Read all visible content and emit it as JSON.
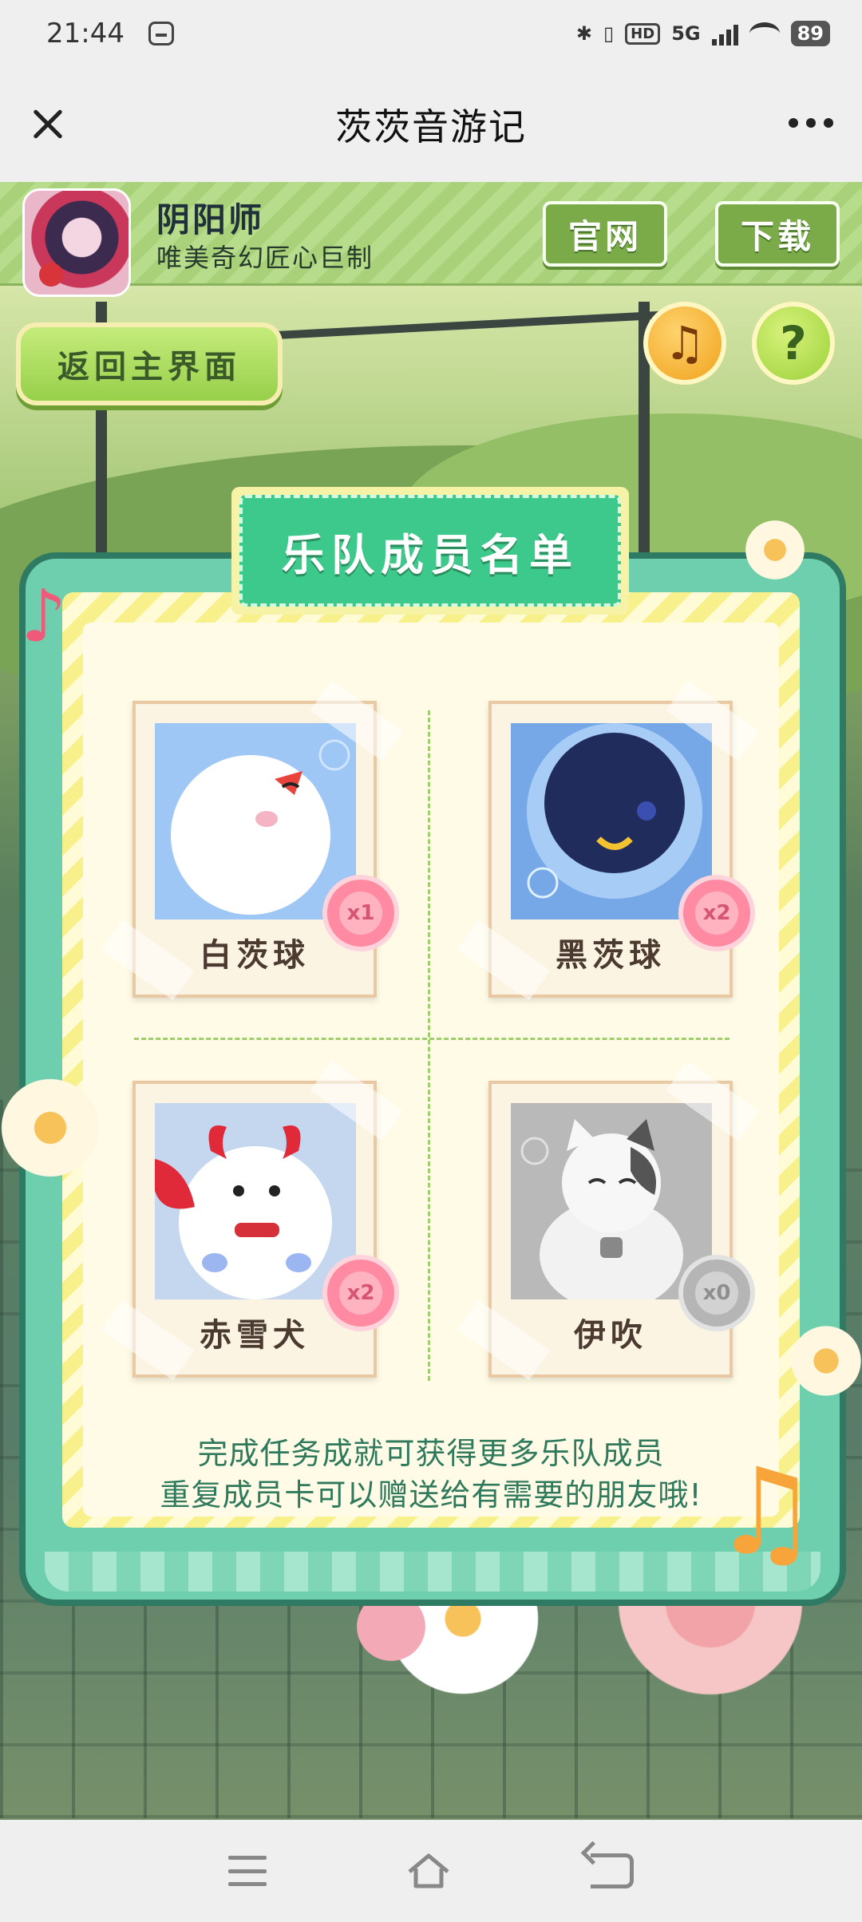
{
  "status_bar": {
    "time": "21:44",
    "indicators": [
      "bluetooth-icon",
      "vibrate-icon",
      "HD",
      "5G",
      "signal-icon",
      "wifi-icon"
    ],
    "hd": "HD",
    "network": "5G",
    "battery": "89"
  },
  "title_bar": {
    "title": "茨茨音游记",
    "close_icon": "close-icon",
    "more_icon": "more-icon"
  },
  "banner": {
    "game_name": "阴阳师",
    "slogan": "唯美奇幻匠心巨制",
    "official_label": "官网",
    "download_label": "下载"
  },
  "scene": {
    "back_label": "返回主界面",
    "music_symbol": "♫",
    "help_symbol": "?"
  },
  "panel": {
    "title": "乐队成员名单",
    "members": [
      {
        "name": "白茨球",
        "count": "x1"
      },
      {
        "name": "黑茨球",
        "count": "x2"
      },
      {
        "name": "赤雪犬",
        "count": "x2"
      },
      {
        "name": "伊吹",
        "count": "x0"
      }
    ],
    "tip_line1": "完成任务成就可获得更多乐队成员",
    "tip_line2": "重复成员卡可以赠送给有需要的朋友哦!"
  },
  "nav_bar": {
    "menu_icon": "menu-icon",
    "home_icon": "home-icon",
    "back_icon": "back-icon"
  },
  "colors": {
    "accent_green": "#3ec98c",
    "panel_teal": "#6dcfae",
    "banner_green": "#7bab49",
    "count_pink": "#ff8aa2"
  }
}
